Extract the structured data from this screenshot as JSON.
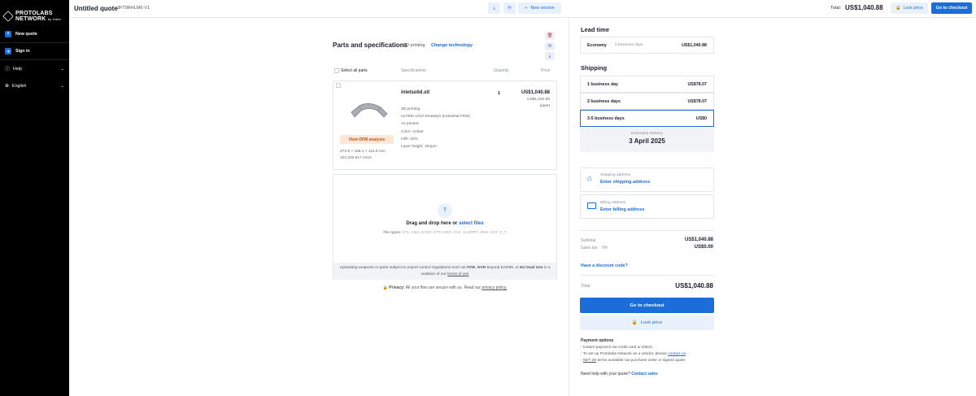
{
  "sidebar": {
    "brand_line1": "PROTOLABS",
    "brand_line2": "NETWORK",
    "brand_by": "by Hubs",
    "items": [
      {
        "label": "New quote",
        "icon": "plus-icon"
      },
      {
        "label": "Sign in",
        "icon": "sign-in-icon"
      }
    ],
    "menus": [
      {
        "label": "Help",
        "icon": "help-icon"
      },
      {
        "label": "English",
        "icon": "globe-icon"
      }
    ]
  },
  "header": {
    "title": "Untitled quote",
    "quote_id": "3FT9RHLM6-V1",
    "new_version_label": "New version",
    "total_label": "Total:",
    "total_value": "US$1,040.88",
    "lock_price_label": "Lock price",
    "checkout_label": "Go to checkout"
  },
  "parts": {
    "title": "Parts and specifications",
    "technology": "3D printing",
    "change_technology_label": "Change technology",
    "select_all_label": "Select all parts",
    "columns": {
      "specifications": "Specifications",
      "quantity": "Quantity",
      "price": "Price"
    },
    "items": [
      {
        "filename": "inletsolid.stl",
        "dfm_label": "View DFM analysis",
        "dimensions": "272.5 × 186.1 × 115.8 mm",
        "volume": "102,200.617 mm3",
        "specs": [
          "3D printing",
          "ULTEM 1010 Stratasys (Industrial FDM)",
          "As printed",
          "Color: Amber",
          "Infill: 20%",
          "Layer height: 254μm"
        ],
        "quantity": "1",
        "price_total": "US$1,040.88",
        "price_unit": "US$1,040.88",
        "price_unit_suffix": "p/part"
      }
    ]
  },
  "upload": {
    "drag_text": "Drag and drop here or",
    "select_files_label": "select files",
    "file_types_label": "File types:",
    "file_types": "STL, OBJ, STEP, STP, IGES, IGS, SLDPRT, 3DM, SAT, X_T",
    "notice_pre": "Uploading weapons or parts subject to export control regulations such as",
    "notice_itar": "ITAR",
    "notice_comma": ",",
    "notice_ear": "EAR",
    "notice_beyond": "beyond EAR99, or",
    "notice_eu": "EU Dual Use",
    "notice_violation": "is a violation of our",
    "notice_terms": "terms of use",
    "privacy_bold": "Privacy:",
    "privacy_text": "All your files are secure with us. Read our",
    "privacy_link": "privacy policy."
  },
  "lead_time": {
    "title": "Lead time",
    "option_name": "Economy",
    "option_days": "3 business days",
    "option_price": "US$1,040.88"
  },
  "shipping": {
    "title": "Shipping",
    "options": [
      {
        "label": "1 business day",
        "price": "US$78.07"
      },
      {
        "label": "2 business days",
        "price": "US$78.07"
      },
      {
        "label": "3-5 business days",
        "price": "US$0"
      }
    ],
    "estimated_label": "Estimated delivery",
    "estimated_date": "3 April 2025"
  },
  "address": {
    "shipping_label": "Shipping address",
    "shipping_action": "Enter shipping address",
    "billing_label": "Billing address",
    "billing_action": "Enter billing address"
  },
  "summary": {
    "subtotal_label": "Subtotal",
    "subtotal_value": "US$1,040.88",
    "tax_label": "Sales tax",
    "tax_rate": "0%",
    "tax_value": "US$0.00",
    "discount_label": "Have a discount code?",
    "total_label": "Total",
    "total_value": "US$1,040.88",
    "checkout_label": "Go to checkout",
    "lock_price_label": "Lock price"
  },
  "payment": {
    "title": "Payment options",
    "line1": "Instant payment via credit card or iDEAL",
    "line2_pre": "To set up Protolabs Network as a vendor, please",
    "line2_link": "contact us",
    "line3_net": "NET 30",
    "line3_rest": "terms available via purchase order or signed quote",
    "help_pre": "Need help with your quote?",
    "help_link": "Contact sales"
  },
  "colors": {
    "accent": "#1c6cd9",
    "sidebar": "#000000",
    "dfm_bg": "#fde7d6",
    "dfm_text": "#c0541a"
  }
}
